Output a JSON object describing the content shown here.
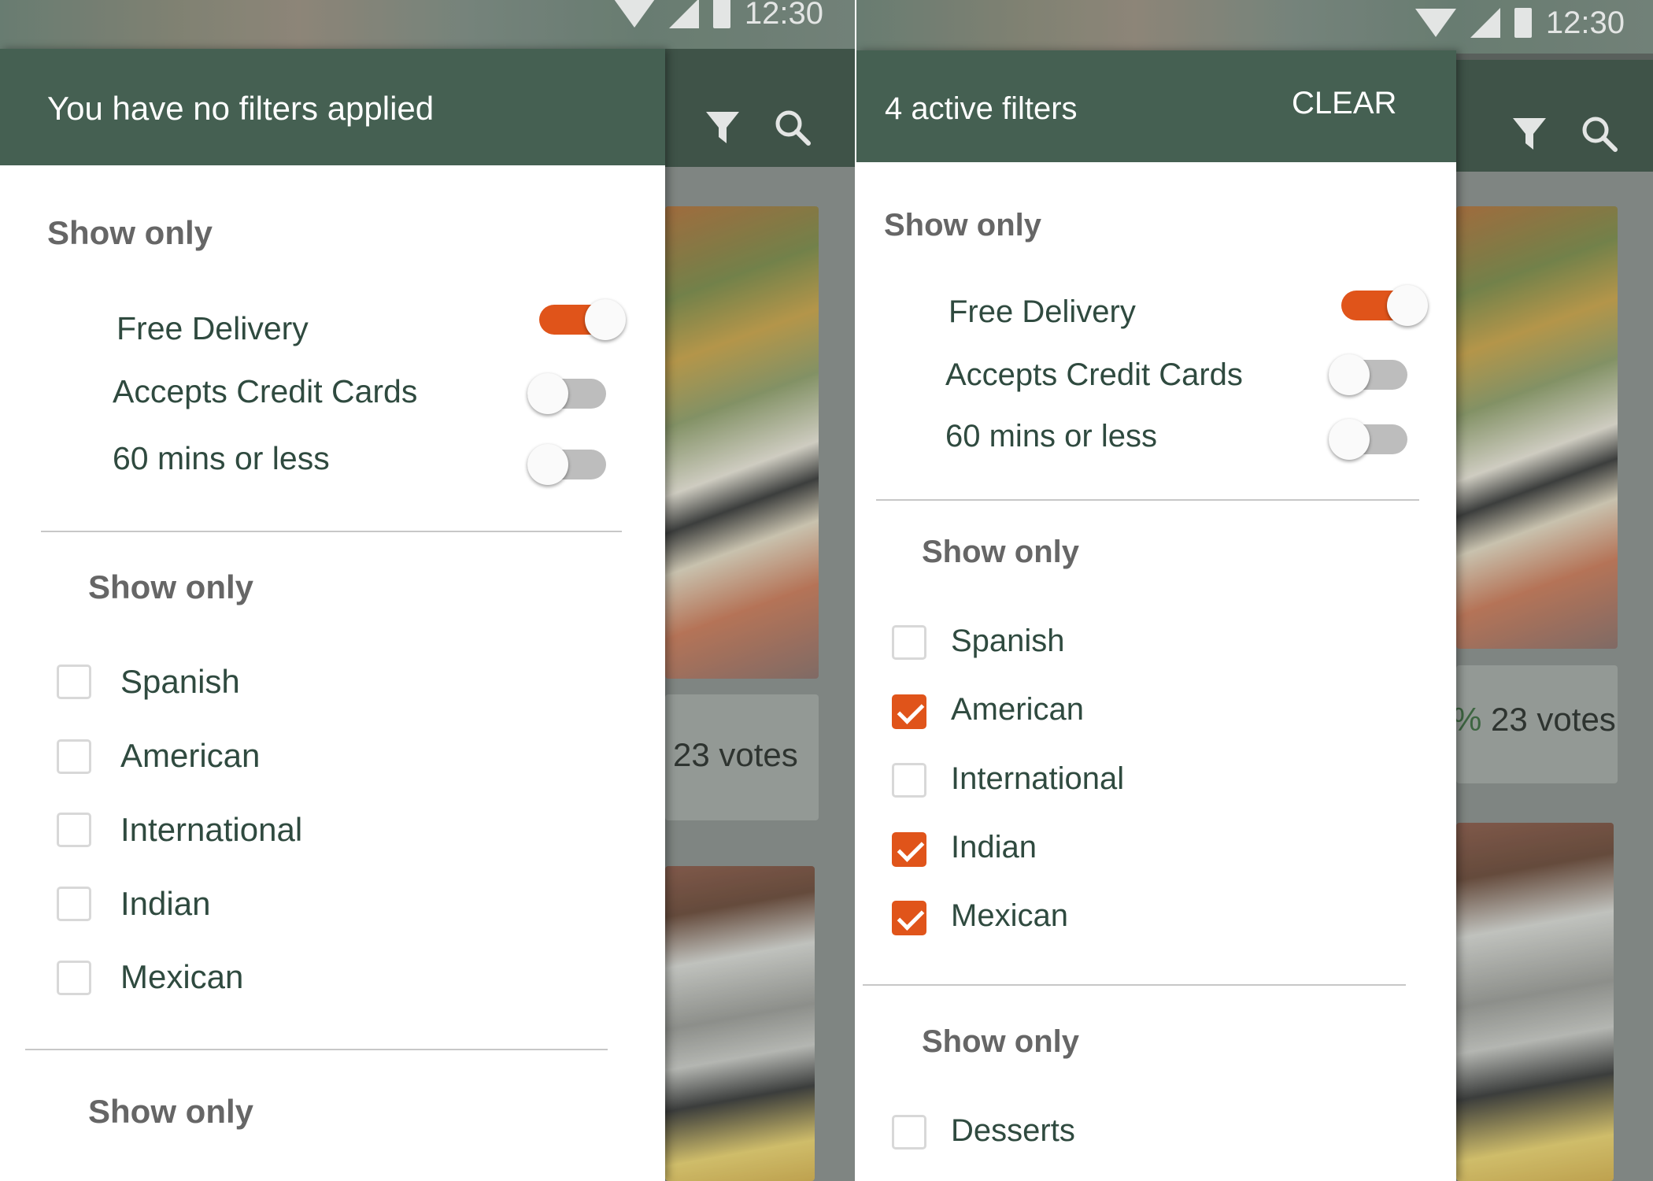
{
  "status_bar": {
    "time": "12:30"
  },
  "background": {
    "votes_text": "23 votes",
    "votes_prefix": "%"
  },
  "left_panel": {
    "header_title": "You have no filters applied",
    "section_toggles_title": "Show only",
    "toggles": [
      {
        "label": "Free Delivery",
        "on": true
      },
      {
        "label": "Accepts Credit Cards",
        "on": false
      },
      {
        "label": "60 mins or less",
        "on": false
      }
    ],
    "section_cuisine_title": "Show only",
    "cuisines": [
      {
        "label": "Spanish",
        "checked": false
      },
      {
        "label": "American",
        "checked": false
      },
      {
        "label": "International",
        "checked": false
      },
      {
        "label": "Indian",
        "checked": false
      },
      {
        "label": "Mexican",
        "checked": false
      }
    ],
    "section_third_title": "Show only"
  },
  "right_panel": {
    "header_title": "4 active filters",
    "clear_label": "CLEAR",
    "section_toggles_title": "Show only",
    "toggles": [
      {
        "label": "Free Delivery",
        "on": true
      },
      {
        "label": "Accepts Credit Cards",
        "on": false
      },
      {
        "label": "60 mins or less",
        "on": false
      }
    ],
    "section_cuisine_title": "Show only",
    "cuisines": [
      {
        "label": "Spanish",
        "checked": false
      },
      {
        "label": "American",
        "checked": true
      },
      {
        "label": "International",
        "checked": false
      },
      {
        "label": "Indian",
        "checked": true
      },
      {
        "label": "Mexican",
        "checked": true
      }
    ],
    "section_third_title": "Show only",
    "third_items": [
      {
        "label": "Desserts",
        "checked": false
      }
    ]
  },
  "colors": {
    "accent": "#e0541a",
    "header_green": "#456052",
    "text_green": "#2f4a3f",
    "section_gray": "#666666"
  },
  "icons": [
    "wifi-icon",
    "signal-icon",
    "battery-icon",
    "filter-icon",
    "search-icon",
    "check-icon"
  ]
}
